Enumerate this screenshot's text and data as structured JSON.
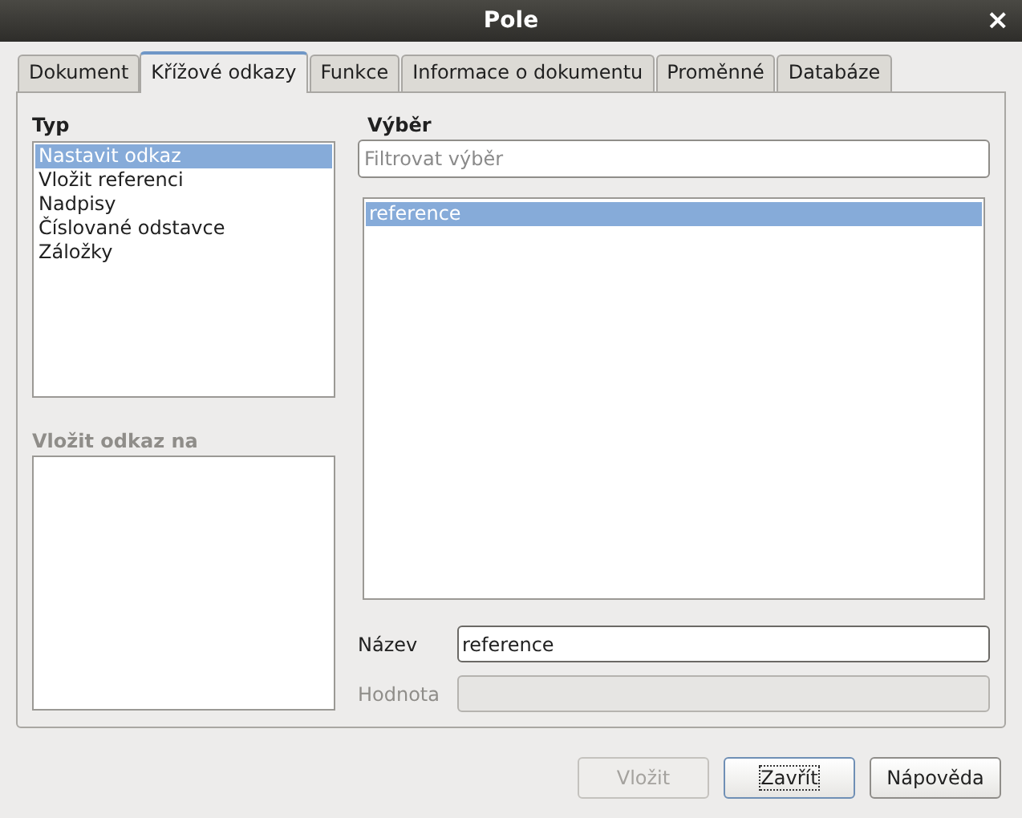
{
  "window": {
    "title": "Pole",
    "close": "×"
  },
  "tabs": [
    {
      "label": "Dokument",
      "selected": false
    },
    {
      "label": "Křížové odkazy",
      "selected": true
    },
    {
      "label": "Funkce",
      "selected": false
    },
    {
      "label": "Informace o dokumentu",
      "selected": false
    },
    {
      "label": "Proměnné",
      "selected": false
    },
    {
      "label": "Databáze",
      "selected": false
    }
  ],
  "type_list": {
    "label": "Typ",
    "items": [
      {
        "label": "Nastavit odkaz",
        "selected": true
      },
      {
        "label": "Vložit referenci",
        "selected": false
      },
      {
        "label": "Nadpisy",
        "selected": false
      },
      {
        "label": "Číslované odstavce",
        "selected": false
      },
      {
        "label": "Záložky",
        "selected": false
      }
    ]
  },
  "insert_ref_list": {
    "label": "Vložit odkaz na",
    "disabled": true
  },
  "selection": {
    "label": "Výběr",
    "filter": {
      "placeholder": "Filtrovat výběr"
    },
    "items": [
      {
        "label": "reference",
        "selected": true
      }
    ]
  },
  "fields": [
    {
      "label": "Název",
      "value": "reference",
      "disabled": false
    },
    {
      "label": "Hodnota",
      "disabled": true
    }
  ],
  "buttons": [
    {
      "label": "Vložit",
      "disabled": true,
      "focused": false
    },
    {
      "label": "Zavřít",
      "disabled": false,
      "focused": true
    },
    {
      "label": "Nápověda",
      "disabled": false,
      "focused": false
    }
  ]
}
